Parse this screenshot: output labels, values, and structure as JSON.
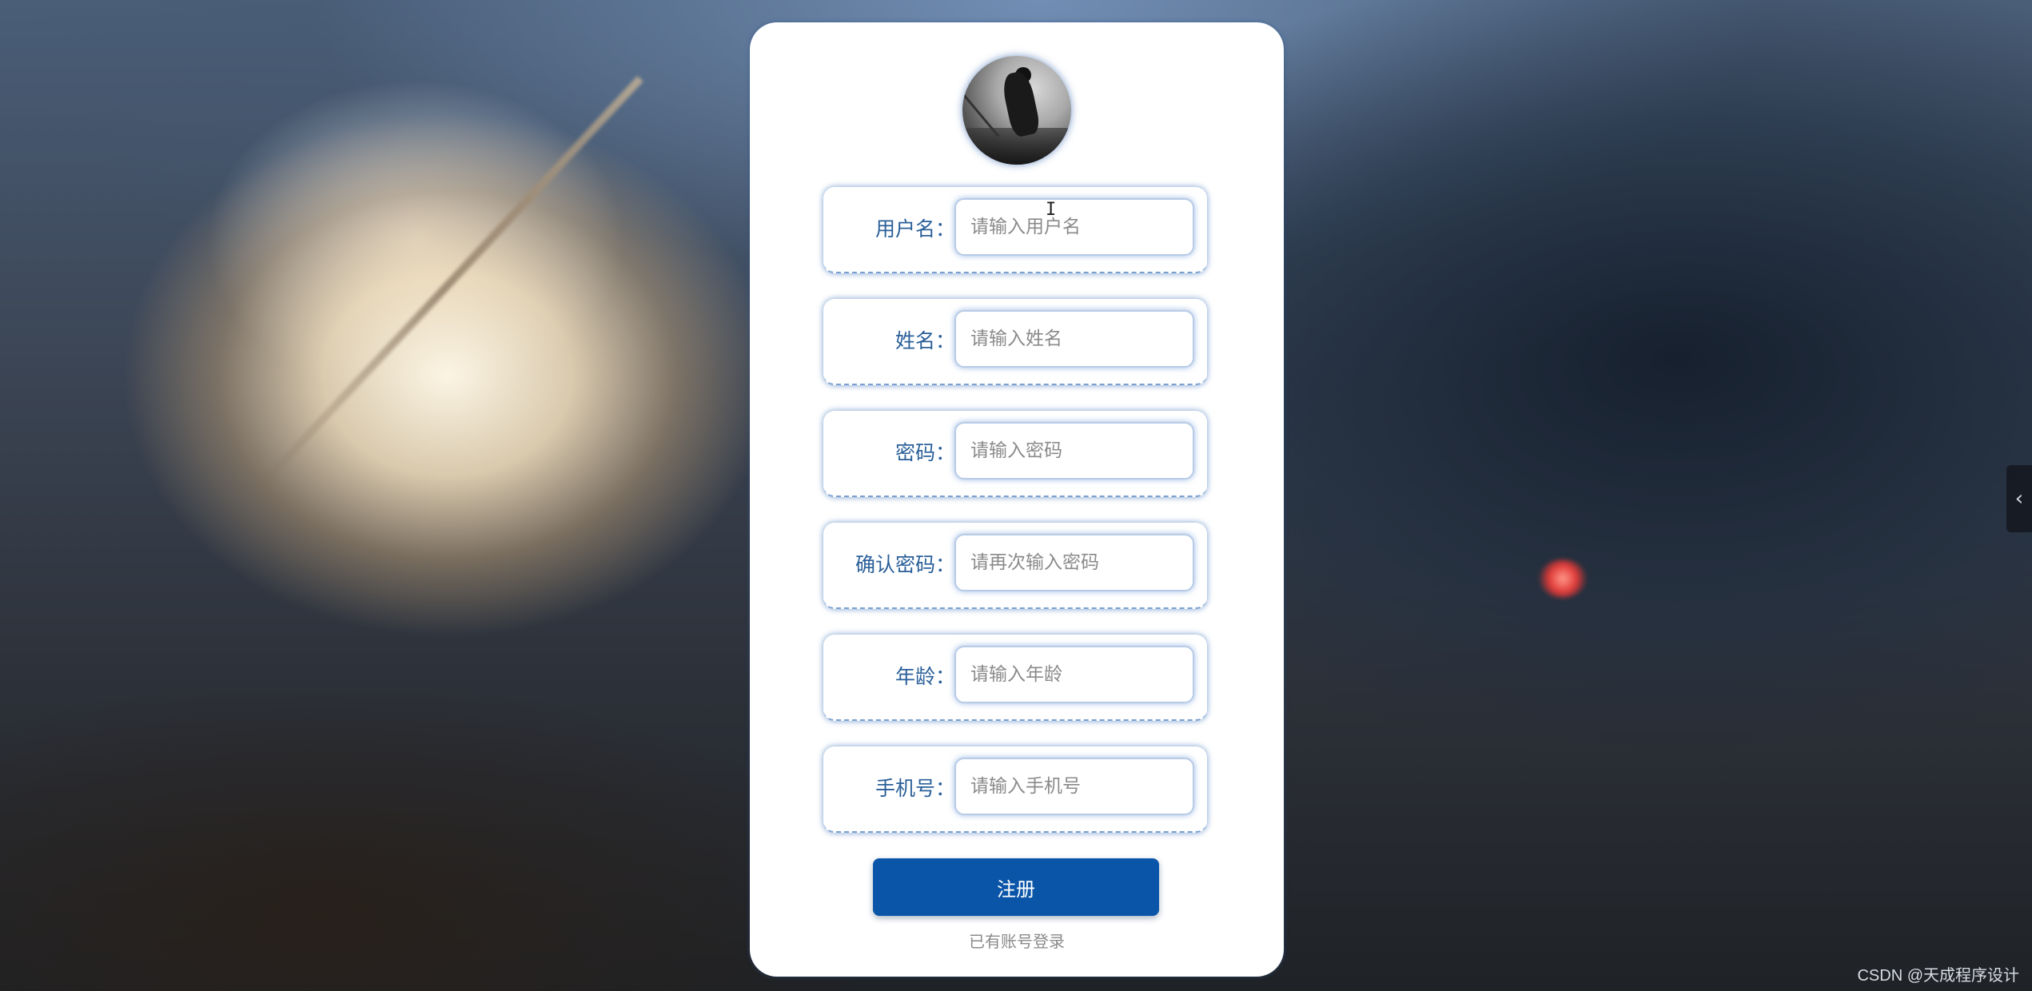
{
  "avatar": {
    "icon": "user-avatar-photo"
  },
  "form": {
    "fields": [
      {
        "label": "用户名",
        "colon": "：",
        "placeholder": "请输入用户名"
      },
      {
        "label": "姓名",
        "colon": "：",
        "placeholder": "请输入姓名"
      },
      {
        "label": "密码",
        "colon": "：",
        "placeholder": "请输入密码"
      },
      {
        "label": "确认密码",
        "colon": "：",
        "placeholder": "请再次输入密码"
      },
      {
        "label": "年龄",
        "colon": "：",
        "placeholder": "请输入年龄"
      },
      {
        "label": "手机号",
        "colon": "：",
        "placeholder": "请输入手机号"
      }
    ],
    "submit_label": "注册",
    "login_link": "已有账号登录"
  },
  "sidebar_toggle": {
    "icon": "chevron-left-icon",
    "glyph": "‹"
  },
  "watermark": "CSDN @天成程序设计",
  "colors": {
    "primary": "#0b55a8",
    "label": "#2a5f99",
    "placeholder": "#8a8a8a"
  }
}
